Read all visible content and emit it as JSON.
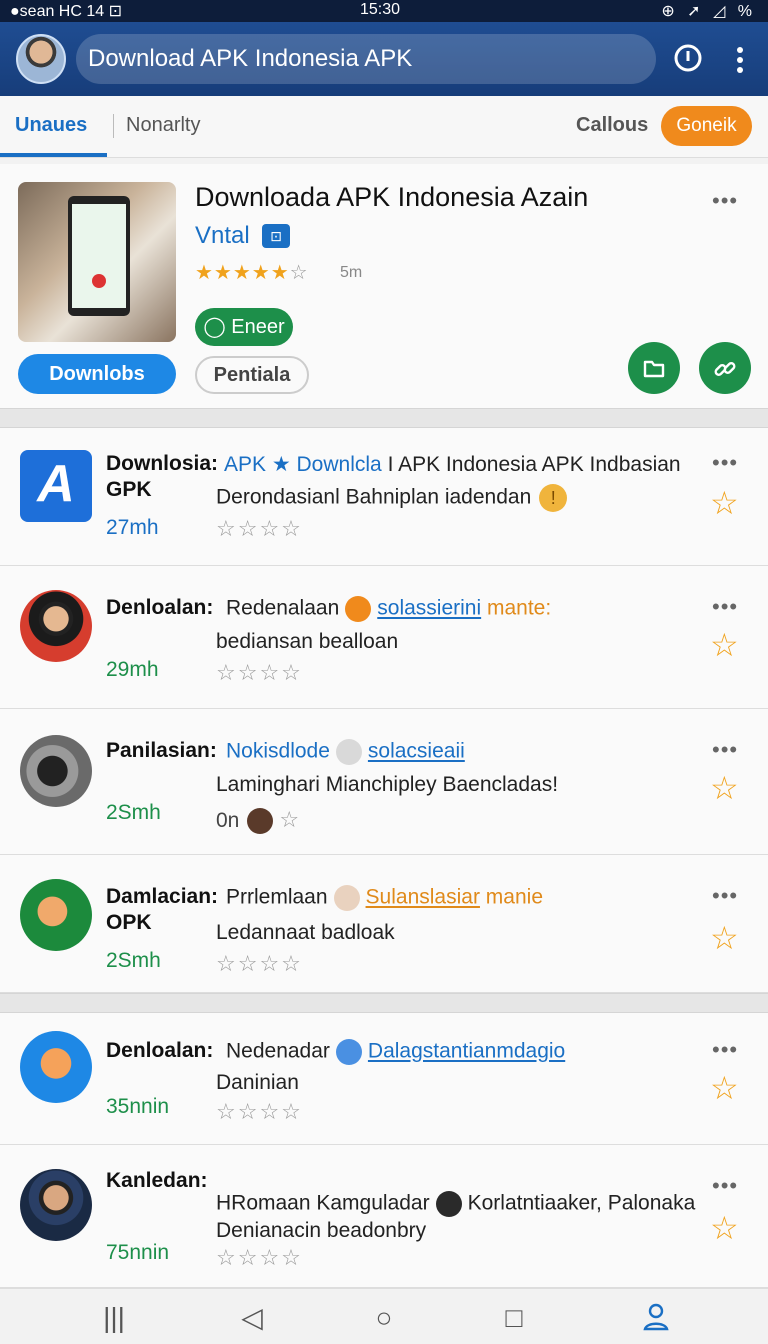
{
  "status_bar": {
    "left": "●sean  HC  14  ⊡",
    "time": "15:30",
    "right": "⊕ ➚ ◿ %"
  },
  "app_bar": {
    "search_value": "Download APK Indonesia APK",
    "info_icon": "info-icon",
    "more_icon": "more-vert-icon"
  },
  "tabs": {
    "tab1": "Unaues",
    "tab2": "Nonarlty",
    "tab3": "Callous",
    "button": "Goneik"
  },
  "featured": {
    "title": "Downloada APK Indonesia Azain",
    "subtitle": "Vntal",
    "badge": "⊡",
    "stars": "★★★★★",
    "stars_empty": "☆",
    "count": "5m",
    "pill": "◯ Eneer",
    "primary_button": "Downlobs",
    "secondary_button": "Pentiala",
    "dots": "•••"
  },
  "items": [
    {
      "title": "Downlosia:",
      "title2": "GPK",
      "line1_blue": "APK ★ Downlcla",
      "line1_rest": "I APK Indonesia APK Indbasian",
      "line2": "Derondasianl Bahniplan iadendan",
      "time": "27mh",
      "stars": "☆☆☆☆",
      "dots": "•••",
      "fav": "☆"
    },
    {
      "title": "Denloalan:",
      "line1_text": "Redenalaan",
      "line1_link": "solassierini",
      "line1_orange": "mante:",
      "line2": "bediansan bealloan",
      "time": "29mh",
      "stars": "☆☆☆☆",
      "dots": "•••",
      "fav": "☆"
    },
    {
      "title": "Panilasian:",
      "line1_blue": "Nokisdlode",
      "line1_link": "solacsieaii",
      "line2": "Laminghari Mianchipley Baencladas!",
      "line3_prefix": "0n",
      "time": "2Smh",
      "stars": "☆",
      "dots": "•••",
      "fav": "☆"
    },
    {
      "title": "Damlacian:",
      "title2": "OPK",
      "line1_text": "Prrlemlaan",
      "line1_olink": "Sulanslasiar",
      "line1_orange": "manie",
      "line2": "Ledannaat badloak",
      "time": "2Smh",
      "stars": "☆☆☆☆",
      "dots": "•••",
      "fav": "☆"
    },
    {
      "title": "Denloalan:",
      "line1_text": "Nedenadar",
      "line1_link": "Dalagstantianmdagio",
      "line2": "Daninian",
      "time": "35nnin",
      "stars": "☆☆☆☆",
      "dots": "•••",
      "fav": "☆"
    },
    {
      "title": "Kanledan:",
      "line1_text": "HRomaan Kamguladar",
      "line1_rest": "Korlatntiaaker, Palonaka",
      "line2": "Denianacin beadonbry",
      "time": "75nnin",
      "stars": "☆☆☆☆",
      "dots": "•••",
      "fav": "☆"
    }
  ],
  "nav": {
    "recents": "|||",
    "back": "◁",
    "home": "○",
    "overview": "□",
    "profile_label": ""
  },
  "colors": {
    "primary": "#1a6fc4",
    "green": "#1d8f4a",
    "orange": "#f08a1c",
    "appbar": "#1f4d92"
  }
}
